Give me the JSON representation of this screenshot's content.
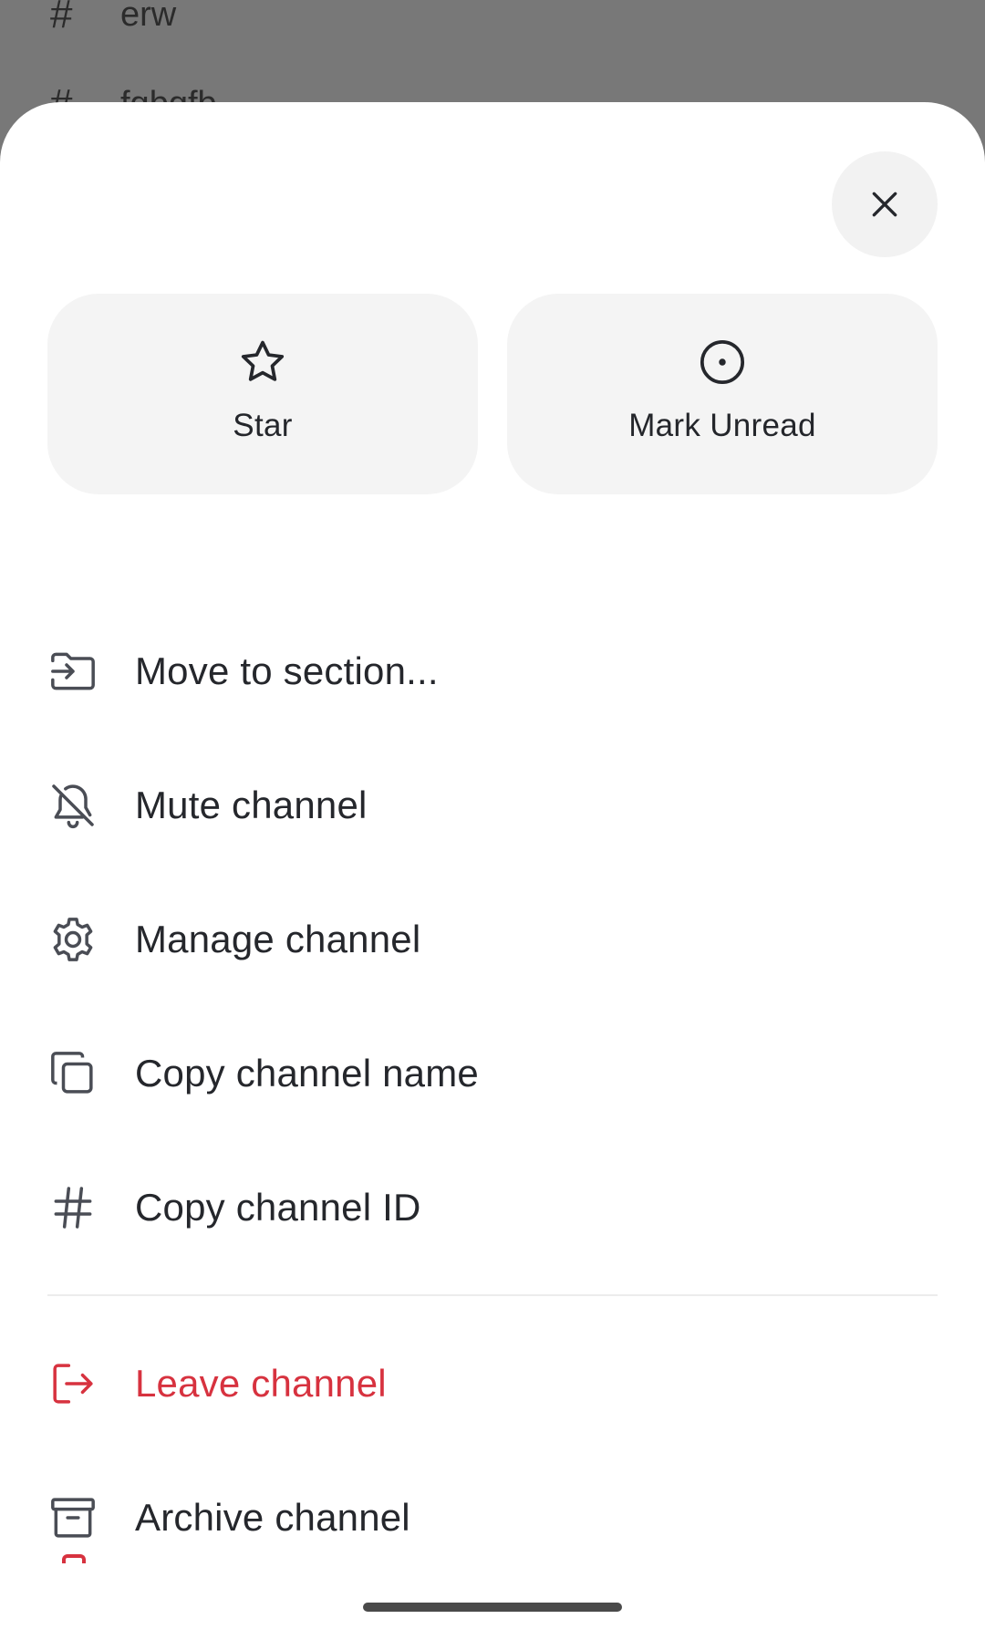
{
  "background": {
    "channels": [
      {
        "hash": "#",
        "name": "erw"
      },
      {
        "hash": "#",
        "name": "fgbgfb"
      }
    ]
  },
  "sheet": {
    "close_icon": "close-icon",
    "quick_actions": [
      {
        "label": "Star",
        "icon": "star-icon"
      },
      {
        "label": "Mark Unread",
        "icon": "circle-dot-icon"
      }
    ],
    "menu": [
      {
        "label": "Move to section...",
        "icon": "folder-move-icon"
      },
      {
        "label": "Mute channel",
        "icon": "bell-off-icon"
      },
      {
        "label": "Manage channel",
        "icon": "gear-icon"
      },
      {
        "label": "Copy channel name",
        "icon": "copy-icon"
      },
      {
        "label": "Copy channel ID",
        "icon": "hash-icon"
      }
    ],
    "danger_menu": [
      {
        "label": "Leave channel",
        "icon": "leave-icon"
      },
      {
        "label": "Archive channel",
        "icon": "archive-icon"
      }
    ]
  },
  "colors": {
    "danger": "#d7323f",
    "text": "#25272c",
    "card_bg": "#f4f4f4",
    "overlay": "#787878"
  }
}
